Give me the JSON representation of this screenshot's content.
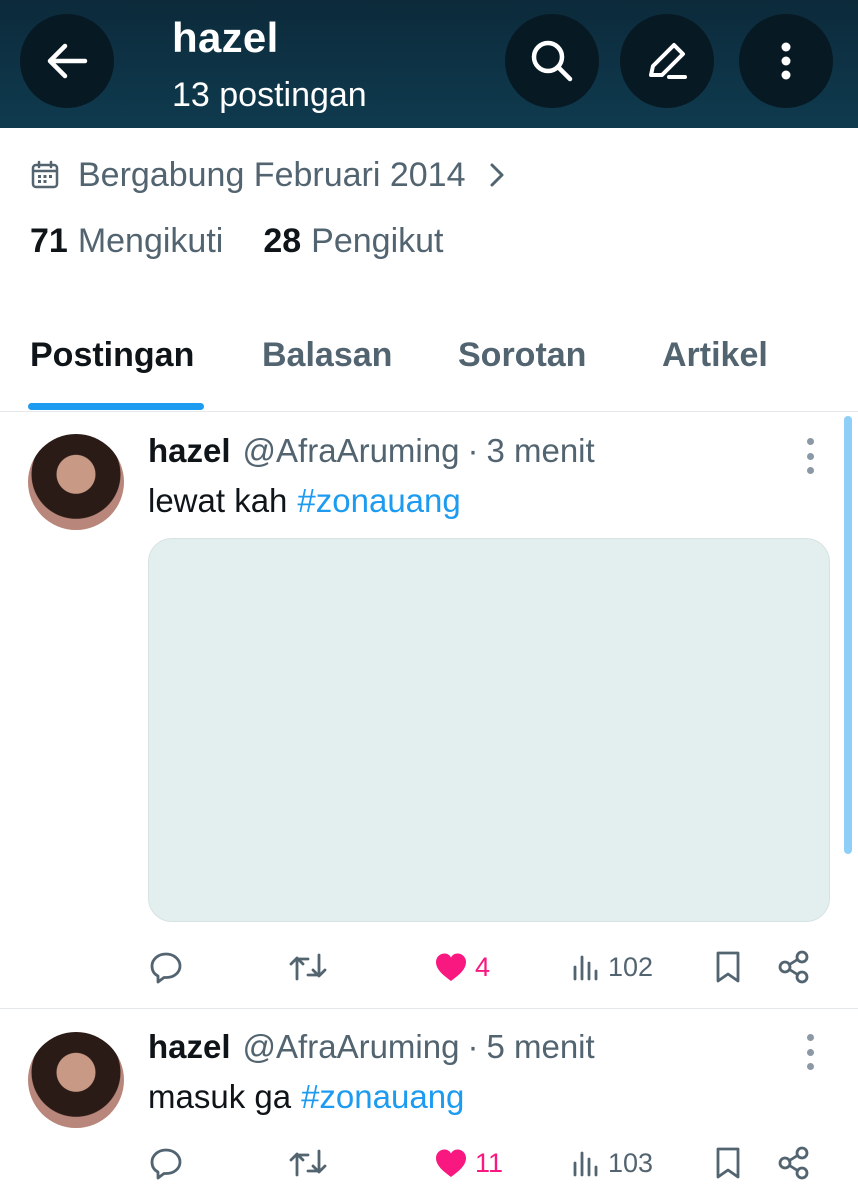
{
  "header": {
    "title": "hazel",
    "subtitle": "13 postingan"
  },
  "profile": {
    "joined": "Bergabung Februari 2014",
    "following_count": "71",
    "following_label": "Mengikuti",
    "followers_count": "28",
    "followers_label": "Pengikut"
  },
  "tabs": [
    {
      "label": "Postingan",
      "active": true
    },
    {
      "label": "Balasan",
      "active": false
    },
    {
      "label": "Sorotan",
      "active": false
    },
    {
      "label": "Artikel",
      "active": false
    }
  ],
  "posts": [
    {
      "name": "hazel",
      "handle": "@AfraAruming",
      "separator": "·",
      "time": "3 menit",
      "text": "lewat kah",
      "hashtag": "#zonauang",
      "has_media": true,
      "likes": "4",
      "views": "102",
      "liked": true
    },
    {
      "name": "hazel",
      "handle": "@AfraAruming",
      "separator": "·",
      "time": "5 menit",
      "text": "masuk ga",
      "hashtag": "#zonauang",
      "has_media": false,
      "likes": "11",
      "views": "103",
      "liked": true
    }
  ],
  "colors": {
    "accent": "#1d9bf0",
    "like": "#f91880",
    "header_bg": "#0e3447",
    "secondary_text": "#536471"
  },
  "icons": [
    "back-arrow-icon",
    "search-icon",
    "compose-icon",
    "more-vertical-icon",
    "calendar-icon",
    "chevron-right-icon",
    "reply-icon",
    "retweet-icon",
    "heart-icon",
    "views-icon",
    "bookmark-icon",
    "share-icon"
  ]
}
